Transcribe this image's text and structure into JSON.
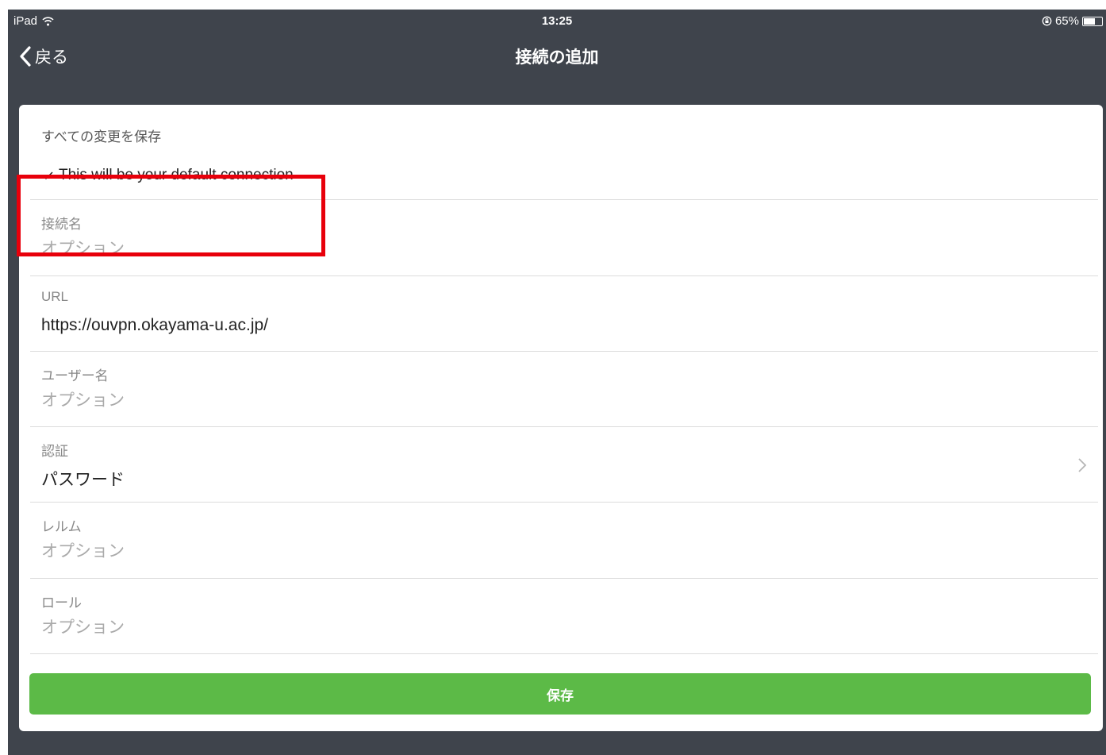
{
  "status_bar": {
    "device": "iPad",
    "time": "13:25",
    "battery_percent": "65%",
    "battery_level": 0.65,
    "wifi_icon": "wifi-icon",
    "lock_icon": "rotation-lock-icon"
  },
  "nav": {
    "back_label": "戻る",
    "title": "接続の追加"
  },
  "form": {
    "save_all_label": "すべての変更を保存",
    "default_connection_text": "This will be your default connection",
    "fields": [
      {
        "label": "接続名",
        "value": "",
        "placeholder": "オプション"
      },
      {
        "label": "URL",
        "value": "https://ouvpn.okayama-u.ac.jp/",
        "placeholder": ""
      },
      {
        "label": "ユーザー名",
        "value": "",
        "placeholder": "オプション"
      },
      {
        "label": "認証",
        "value": "パスワード",
        "placeholder": ""
      },
      {
        "label": "レルム",
        "value": "",
        "placeholder": "オプション"
      },
      {
        "label": "ロール",
        "value": "",
        "placeholder": "オプション"
      }
    ],
    "save_button_label": "保存"
  },
  "colors": {
    "background": "#3f444c",
    "save_button": "#5cba47",
    "highlight": "#e8000b"
  }
}
